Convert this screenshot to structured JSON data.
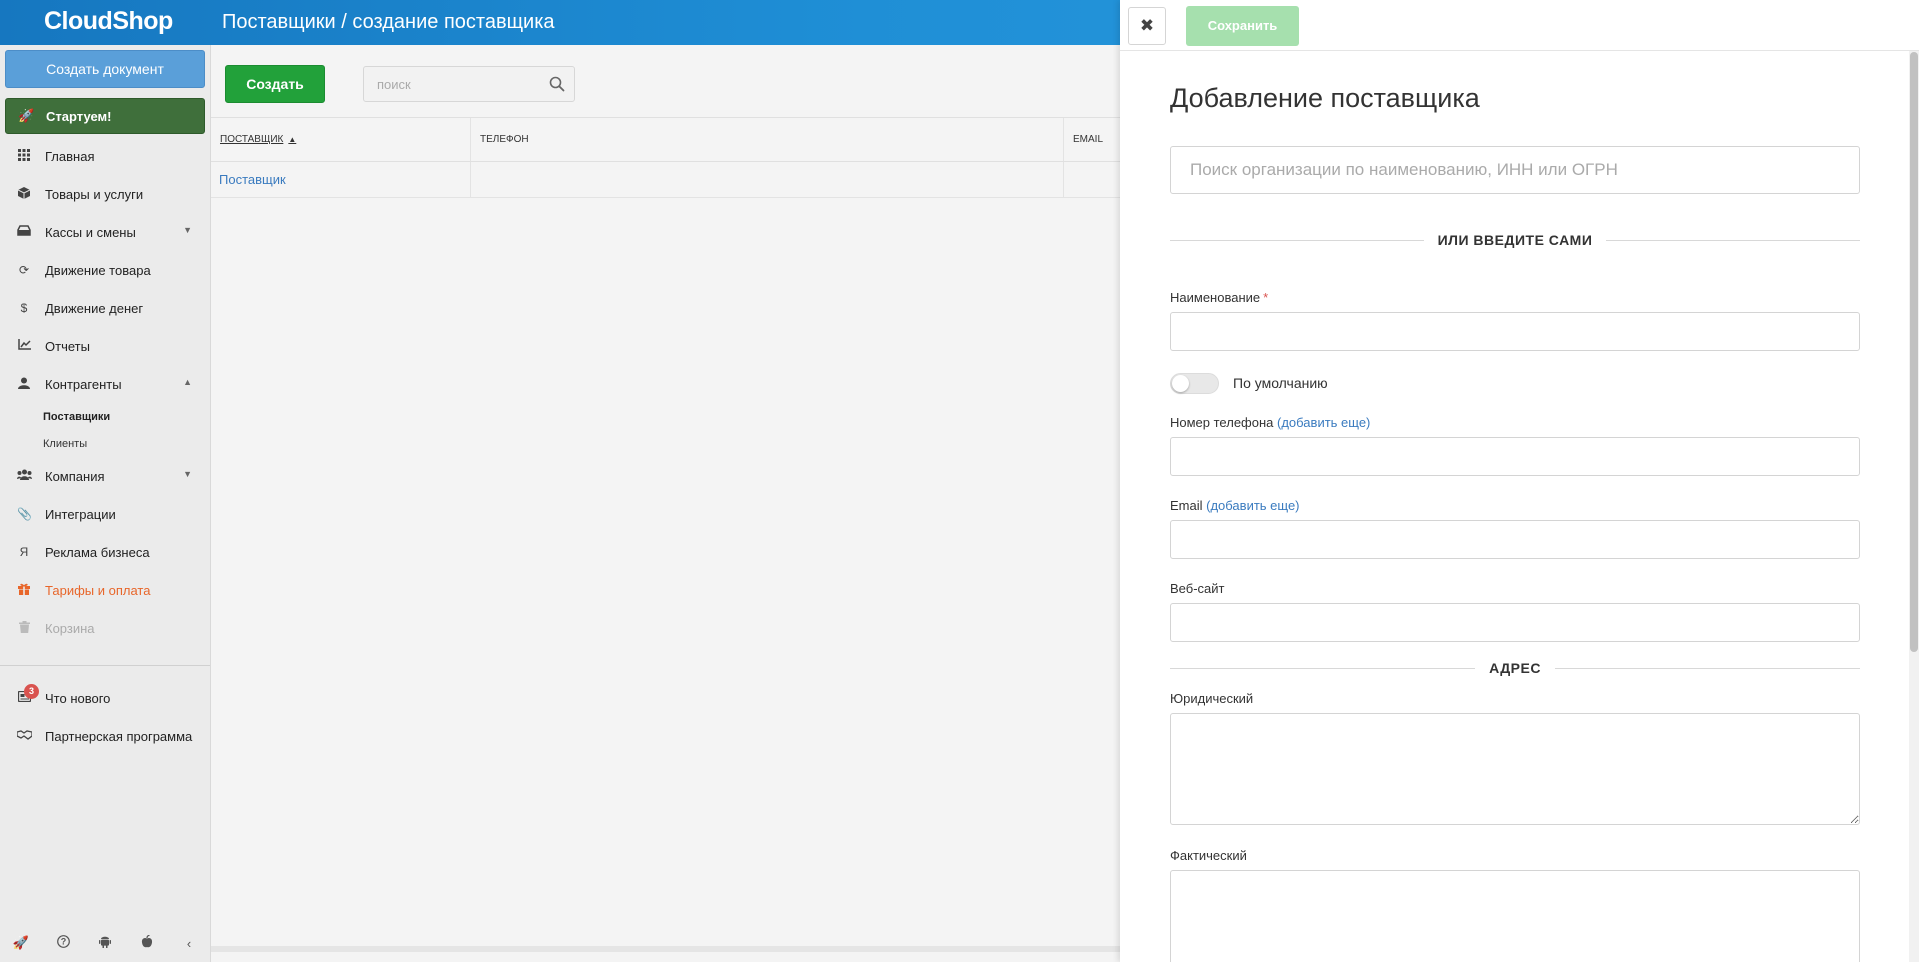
{
  "header": {
    "logo": "CloudShop",
    "title": "Поставщики / создание поставщика"
  },
  "sidebar": {
    "create_document": "Создать документ",
    "start": "Стартуем!",
    "items": [
      {
        "label": "Главная",
        "icon": "grid-icon"
      },
      {
        "label": "Товары и услуги",
        "icon": "box-icon"
      },
      {
        "label": "Кассы и смены",
        "icon": "cash-register-icon"
      },
      {
        "label": "Движение товара",
        "icon": "refresh-icon"
      },
      {
        "label": "Движение денег",
        "icon": "dollar-icon"
      },
      {
        "label": "Отчеты",
        "icon": "chart-icon"
      },
      {
        "label": "Контрагенты",
        "icon": "user-icon"
      },
      {
        "label": "Компания",
        "icon": "users-icon"
      },
      {
        "label": "Интеграции",
        "icon": "paperclip-icon"
      },
      {
        "label": "Реклама бизнеса",
        "icon": "yandex-icon"
      },
      {
        "label": "Тарифы и оплата",
        "icon": "gift-icon"
      },
      {
        "label": "Корзина",
        "icon": "trash-icon"
      }
    ],
    "subitems": [
      {
        "label": "Поставщики"
      },
      {
        "label": "Клиенты"
      }
    ],
    "bottom": [
      {
        "label": "Что нового",
        "badge": "3",
        "icon": "news-icon"
      },
      {
        "label": "Партнерская программа",
        "icon": "handshake-icon"
      }
    ]
  },
  "main": {
    "create_button": "Создать",
    "search_placeholder": "поиск",
    "columns": [
      "поставщик",
      "телефон",
      "email"
    ],
    "rows": [
      {
        "name": "Поставщик",
        "phone": "",
        "email": ""
      }
    ]
  },
  "panel": {
    "save_button": "Сохранить",
    "title": "Добавление поставщика",
    "org_search_placeholder": "Поиск организации по наименованию, ИНН или ОГРН",
    "or_enter": "или введите сами",
    "name_label": "Наименование",
    "default_label": "По умолчанию",
    "phone_label": "Номер телефона",
    "email_label": "Email",
    "add_more": "(добавить еще)",
    "website_label": "Веб-сайт",
    "address_header": "Адрес",
    "legal_label": "Юридический",
    "actual_label": "Фактический"
  },
  "colors": {
    "header_blue": "#1677c0",
    "create_green": "#22a13a",
    "save_disabled": "#a6e0ae",
    "start_green": "#3f6f3b",
    "link_blue": "#3a7bbf",
    "accent_orange": "#e8662a",
    "badge_red": "#d9534f"
  }
}
